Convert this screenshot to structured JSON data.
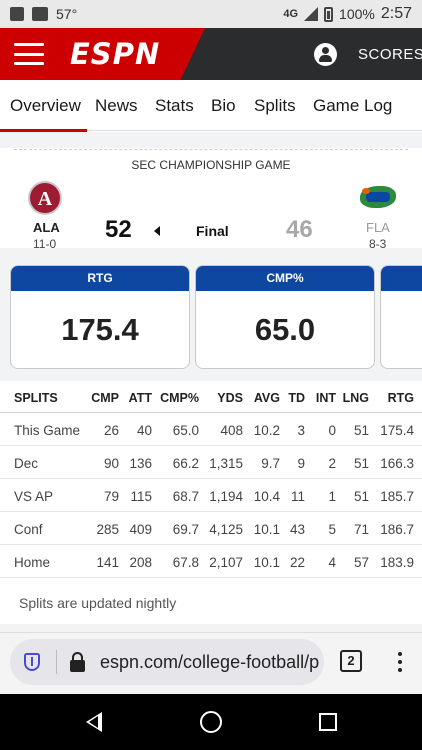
{
  "status_bar": {
    "temperature": "57°",
    "network": "4G",
    "battery": "100%",
    "time": "2:57"
  },
  "header": {
    "logo": "ESPN",
    "scores_label": "SCORES"
  },
  "tabs": [
    "Overview",
    "News",
    "Stats",
    "Bio",
    "Splits",
    "Game Log"
  ],
  "game": {
    "title": "SEC CHAMPIONSHIP GAME",
    "status": "Final",
    "home": {
      "abbr": "ALA",
      "record": "11-0",
      "score": "52",
      "logo_letter": "A"
    },
    "away": {
      "abbr": "FLA",
      "record": "8-3",
      "score": "46"
    }
  },
  "cards": [
    {
      "label": "RTG",
      "value": "175.4"
    },
    {
      "label": "CMP%",
      "value": "65.0"
    },
    {
      "label": "",
      "value": ""
    }
  ],
  "splits": {
    "columns": [
      "SPLITS",
      "CMP",
      "ATT",
      "CMP%",
      "YDS",
      "AVG",
      "TD",
      "INT",
      "LNG",
      "RTG"
    ],
    "rows": [
      [
        "This Game",
        "26",
        "40",
        "65.0",
        "408",
        "10.2",
        "3",
        "0",
        "51",
        "175.4"
      ],
      [
        "Dec",
        "90",
        "136",
        "66.2",
        "1,315",
        "9.7",
        "9",
        "2",
        "51",
        "166.3"
      ],
      [
        "VS AP",
        "79",
        "115",
        "68.7",
        "1,194",
        "10.4",
        "11",
        "1",
        "51",
        "185.7"
      ],
      [
        "Conf",
        "285",
        "409",
        "69.7",
        "4,125",
        "10.1",
        "43",
        "5",
        "71",
        "186.7"
      ],
      [
        "Home",
        "141",
        "208",
        "67.8",
        "2,107",
        "10.1",
        "22",
        "4",
        "57",
        "183.9"
      ]
    ],
    "note": "Splits are updated nightly"
  },
  "browser": {
    "url": "espn.com/college-football/p",
    "tab_count": "2"
  },
  "colors": {
    "espn_red": "#cc0000",
    "card_header_blue": "#0d47a1",
    "header_dark": "#2b2c2d"
  }
}
